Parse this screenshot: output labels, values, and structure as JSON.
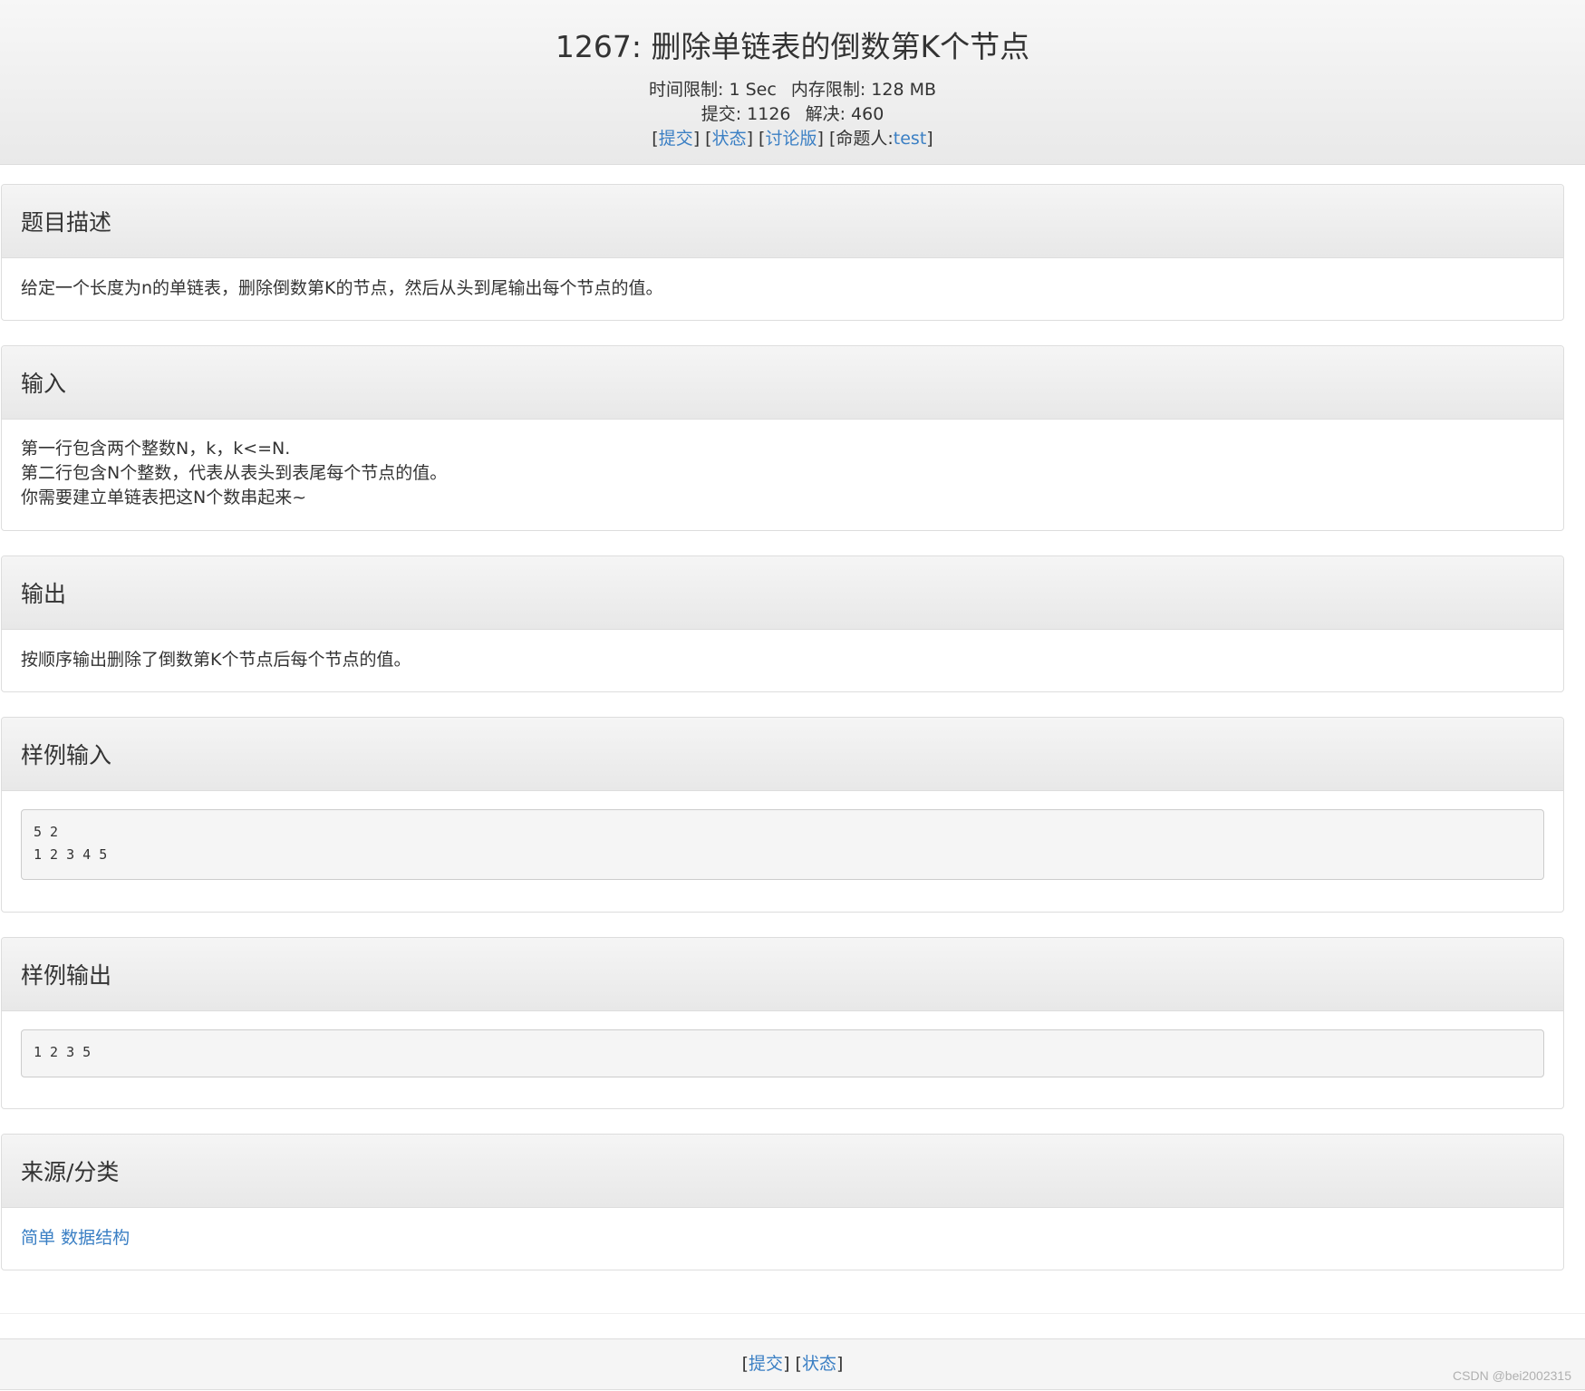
{
  "header": {
    "title": "1267: 删除单链表的倒数第K个节点",
    "time_limit_label": "时间限制:",
    "time_limit_value": "1 Sec",
    "memory_limit_label": "内存限制:",
    "memory_limit_value": "128 MB",
    "submit_count_label": "提交:",
    "submit_count_value": "1126",
    "solved_label": "解决:",
    "solved_value": "460",
    "links": {
      "submit": "提交",
      "status": "状态",
      "discuss": "讨论版",
      "author_label": "命题人:",
      "author": "test"
    }
  },
  "sections": {
    "description": {
      "heading": "题目描述",
      "text": "给定一个长度为n的单链表，删除倒数第K的节点，然后从头到尾输出每个节点的值。"
    },
    "input": {
      "heading": "输入",
      "lines": [
        "第一行包含两个整数N，k，k<=N.",
        "第二行包含N个整数，代表从表头到表尾每个节点的值。",
        "你需要建立单链表把这N个数串起来~"
      ]
    },
    "output": {
      "heading": "输出",
      "text": "按顺序输出删除了倒数第K个节点后每个节点的值。"
    },
    "sample_input": {
      "heading": "样例输入",
      "code": "5 2\n1 2 3 4 5"
    },
    "sample_output": {
      "heading": "样例输出",
      "code": "1 2 3 5"
    },
    "source": {
      "heading": "来源/分类",
      "tags": [
        "简单",
        "数据结构"
      ]
    }
  },
  "footer": {
    "submit": "提交",
    "status": "状态"
  },
  "watermark": "CSDN @bei2002315",
  "colors": {
    "link": "#3a7fc4",
    "text": "#333333",
    "panel_border": "#dddddd"
  }
}
